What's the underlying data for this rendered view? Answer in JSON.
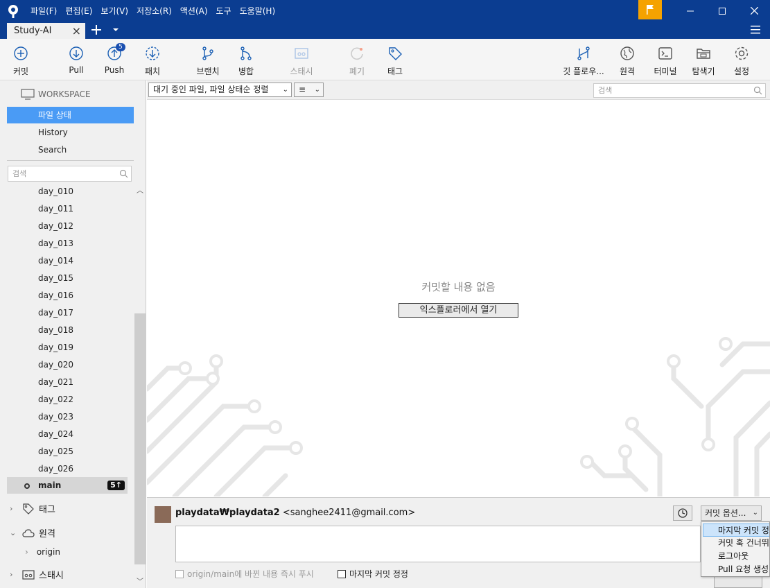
{
  "menu": [
    "파일(F)",
    "편집(E)",
    "보기(V)",
    "저장소(R)",
    "액션(A)",
    "도구",
    "도움말(H)"
  ],
  "tab": {
    "title": "Study-AI"
  },
  "toolbar": {
    "commit": "커밋",
    "pull": "Pull",
    "push": "Push",
    "push_badge": "5",
    "fetch": "패치",
    "branch": "브랜치",
    "merge": "병합",
    "stash": "스태시",
    "discard": "폐기",
    "tag": "태그",
    "gitflow": "깃 플로우...",
    "remote": "원격",
    "terminal": "터미널",
    "explorer": "탐색기",
    "settings": "설정"
  },
  "sidebar": {
    "workspace": "WORKSPACE",
    "items": [
      "파일 상태",
      "History",
      "Search"
    ],
    "search_placeholder": "검색",
    "branches": [
      "day_010",
      "day_011",
      "day_012",
      "day_013",
      "day_014",
      "day_015",
      "day_016",
      "day_017",
      "day_018",
      "day_019",
      "day_020",
      "day_021",
      "day_022",
      "day_023",
      "day_024",
      "day_025",
      "day_026"
    ],
    "main_branch": "main",
    "main_badge": "5↑",
    "tags": "태그",
    "remotes": "원격",
    "origin": "origin",
    "stashes": "스태시"
  },
  "content": {
    "filter": "대기 중인 파일, 파일 상태순 정렬",
    "view_icon": "≡",
    "search_placeholder": "검색",
    "empty_message": "커밋할 내용 없음",
    "open_explorer": "익스플로러에서 열기"
  },
  "commit": {
    "author_name": "playdata₩playdata2",
    "author_email": "<sanghee2411@gmail.com>",
    "options": "커밋 옵션...",
    "push_immediately": "origin/main에 바뀐 내용 즉시 푸시",
    "amend": "마지막 커밋 정정"
  },
  "dropdown": [
    "마지막 커밋 정정",
    "커밋 훅 건너뛰기",
    "로그아웃",
    "Pull 요청 생성"
  ],
  "colors": {
    "titlebar": "#0b3d91",
    "selection": "#4a9bf5",
    "flag": "#f5a200"
  }
}
